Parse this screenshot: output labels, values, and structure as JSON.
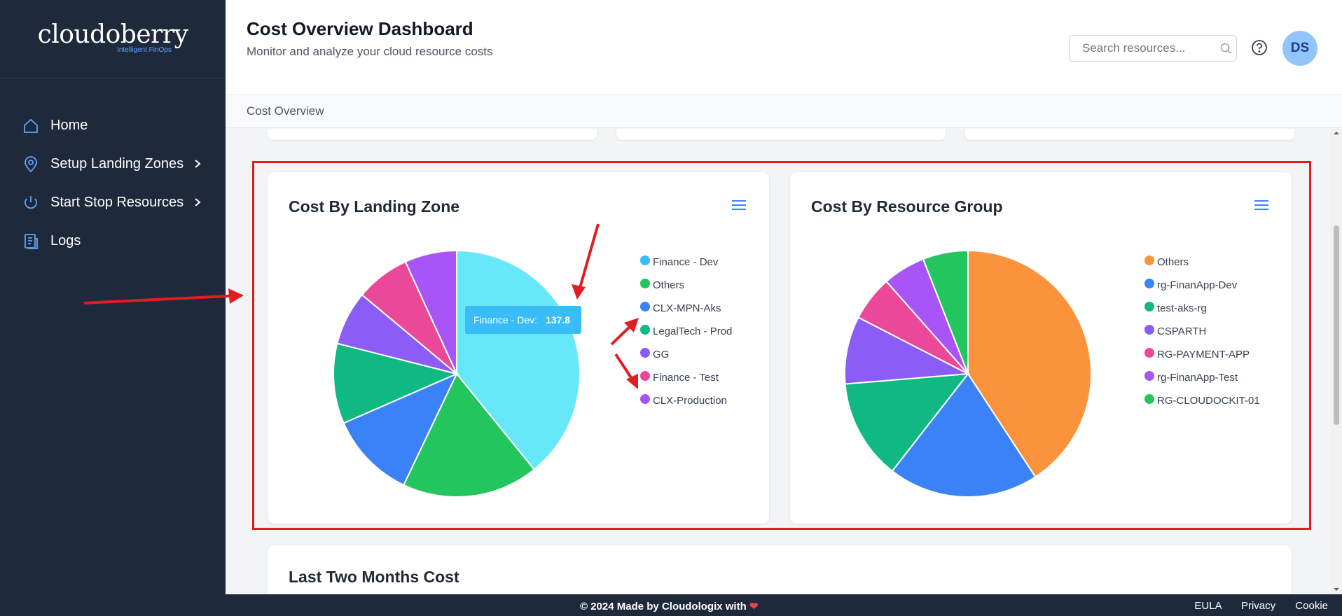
{
  "brand": {
    "name": "cloudoberry",
    "tagline": "Intelligent FinOps"
  },
  "sidebar": {
    "items": [
      {
        "label": "Home",
        "icon": "home-icon",
        "chevron": false
      },
      {
        "label": "Setup Landing Zones",
        "icon": "location-pin-icon",
        "chevron": true
      },
      {
        "label": "Start Stop Resources",
        "icon": "power-icon",
        "chevron": true
      },
      {
        "label": "Logs",
        "icon": "document-icon",
        "chevron": false
      }
    ]
  },
  "header": {
    "title": "Cost Overview Dashboard",
    "subtitle": "Monitor and analyze your cloud resource costs",
    "search_placeholder": "Search resources...",
    "avatar_initials": "DS"
  },
  "breadcrumb": "Cost Overview",
  "top_cards": [
    {
      "accent": "#3b82f6"
    },
    {
      "accent": "#f97316"
    },
    {
      "accent": "#22c55e"
    }
  ],
  "landing_zone_chart": {
    "title": "Cost By Landing Zone",
    "tooltip": {
      "label": "Finance - Dev:",
      "value": "137.8"
    },
    "chart_data": {
      "type": "pie",
      "slices": [
        {
          "label": "Finance - Dev",
          "value": 137.8,
          "color": "#67e8f9"
        },
        {
          "label": "Others",
          "value": 63,
          "color": "#22c55e"
        },
        {
          "label": "CLX-MPN-Aks",
          "value": 40,
          "color": "#3b82f6"
        },
        {
          "label": "LegalTech - Prod",
          "value": 37,
          "color": "#10b981"
        },
        {
          "label": "GG",
          "value": 25,
          "color": "#8b5cf6"
        },
        {
          "label": "Finance - Test",
          "value": 25,
          "color": "#ec4899"
        },
        {
          "label": "CLX-Production",
          "value": 24,
          "color": "#a855f7"
        }
      ],
      "legend": [
        {
          "label": "Finance - Dev",
          "color": "#38bdf8"
        },
        {
          "label": "Others",
          "color": "#22c55e"
        },
        {
          "label": "CLX-MPN-Aks",
          "color": "#3b82f6"
        },
        {
          "label": "LegalTech - Prod",
          "color": "#10b981"
        },
        {
          "label": "GG",
          "color": "#8b5cf6"
        },
        {
          "label": "Finance - Test",
          "color": "#ec4899"
        },
        {
          "label": "CLX-Production",
          "color": "#a855f7"
        }
      ]
    }
  },
  "resource_group_chart": {
    "title": "Cost By Resource Group",
    "chart_data": {
      "type": "pie",
      "slices": [
        {
          "label": "Others",
          "value": 124,
          "color": "#fb923c"
        },
        {
          "label": "rg-FinanApp-Dev",
          "value": 60,
          "color": "#3b82f6"
        },
        {
          "label": "test-aks-rg",
          "value": 40,
          "color": "#10b981"
        },
        {
          "label": "CSPARTH",
          "value": 27,
          "color": "#8b5cf6"
        },
        {
          "label": "RG-PAYMENT-APP",
          "value": 18,
          "color": "#ec4899"
        },
        {
          "label": "rg-FinanApp-Test",
          "value": 17,
          "color": "#a855f7"
        },
        {
          "label": "RG-CLOUDOCKIT-01",
          "value": 18,
          "color": "#22c55e"
        }
      ],
      "legend": [
        {
          "label": "Others",
          "color": "#fb923c"
        },
        {
          "label": "rg-FinanApp-Dev",
          "color": "#3b82f6"
        },
        {
          "label": "test-aks-rg",
          "color": "#10b981"
        },
        {
          "label": "CSPARTH",
          "color": "#8b5cf6"
        },
        {
          "label": "RG-PAYMENT-APP",
          "color": "#ec4899"
        },
        {
          "label": "rg-FinanApp-Test",
          "color": "#a855f7"
        },
        {
          "label": "RG-CLOUDOCKIT-01",
          "color": "#22c55e"
        }
      ]
    }
  },
  "last_two_months": {
    "title": "Last Two Months Cost"
  },
  "footer": {
    "copyright": "© 2024 Made by Cloudologix with",
    "links": [
      "EULA",
      "Privacy",
      "Cookie"
    ]
  }
}
